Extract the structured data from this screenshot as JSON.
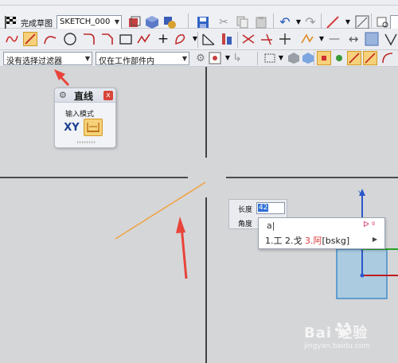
{
  "toolbar1": {
    "finish_sketch_label": "完成草图",
    "sketch_name": "SKETCH_000"
  },
  "toolbar3": {
    "filter_value": "没有选择过滤器",
    "scope_value": "仅在工作部件内"
  },
  "line_dialog": {
    "title": "直线",
    "close_label": "x",
    "input_mode_label": "输入模式",
    "xy_label": "XY"
  },
  "dimension_input": {
    "length_label": "长度",
    "length_value": "42",
    "angle_label": "角度"
  },
  "ime": {
    "composition": "a",
    "candidates": [
      "1.工",
      "2.戈",
      "3.阿"
    ],
    "code_hint": "[bskg]"
  },
  "watermark": {
    "brand": "Bai 经验",
    "url": "jingyan.baidu.com"
  },
  "colors": {
    "sketch_line": "#f0a444",
    "arrow_red": "#e8443a",
    "axis_blue": "#2c57c9",
    "axis_red": "#c21c1c",
    "axis_green": "#28a128",
    "csys_fill": "#aacbe0"
  },
  "icons": {
    "flag": "finish-flag-icon",
    "gear": "gear-icon"
  }
}
